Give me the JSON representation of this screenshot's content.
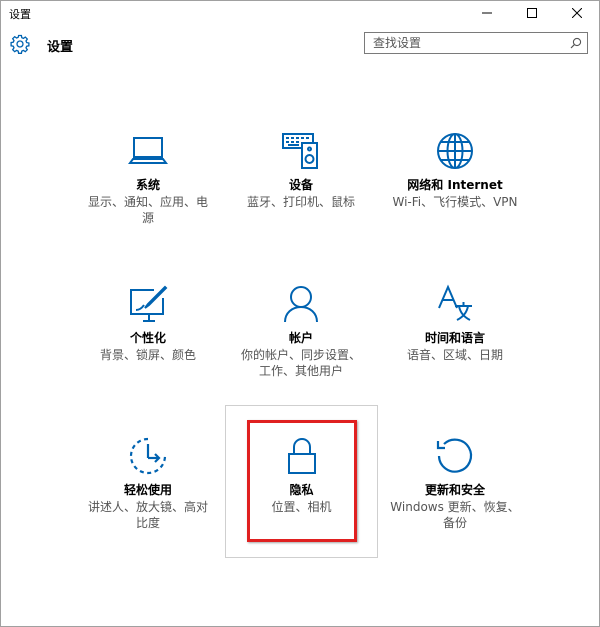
{
  "window": {
    "title": "设置"
  },
  "header": {
    "title": "设置",
    "search_placeholder": "查找设置"
  },
  "colors": {
    "accent": "#0063b1",
    "highlight": "#e02020"
  },
  "tiles": [
    {
      "name": "系统",
      "desc": "显示、通知、应用、电源",
      "icon": "laptop-icon"
    },
    {
      "name": "设备",
      "desc": "蓝牙、打印机、鼠标",
      "icon": "devices-icon"
    },
    {
      "name": "网络和 Internet",
      "desc": "Wi-Fi、飞行模式、VPN",
      "icon": "globe-icon"
    },
    {
      "name": "个性化",
      "desc": "背景、锁屏、颜色",
      "icon": "personalization-icon"
    },
    {
      "name": "帐户",
      "desc": "你的帐户、同步设置、工作、其他用户",
      "icon": "person-icon"
    },
    {
      "name": "时间和语言",
      "desc": "语音、区域、日期",
      "icon": "time-language-icon"
    },
    {
      "name": "轻松使用",
      "desc": "讲述人、放大镜、高对比度",
      "icon": "ease-of-access-icon"
    },
    {
      "name": "隐私",
      "desc": "位置、相机",
      "icon": "lock-icon"
    },
    {
      "name": "更新和安全",
      "desc": "Windows 更新、恢复、备份",
      "icon": "update-icon"
    }
  ]
}
